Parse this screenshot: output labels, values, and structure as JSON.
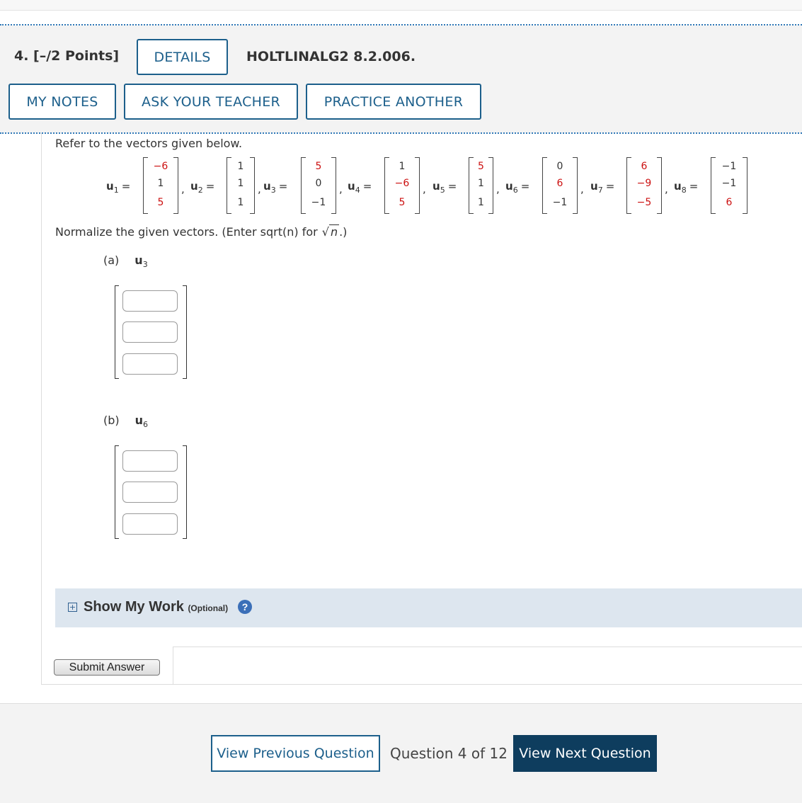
{
  "question": {
    "number_label": "4. [–/2 Points]",
    "details_label": "DETAILS",
    "code": "HOLTLINALG2 8.2.006.",
    "buttons": {
      "my_notes": "MY NOTES",
      "ask_teacher": "ASK YOUR TEACHER",
      "practice_another": "PRACTICE ANOTHER"
    }
  },
  "body": {
    "prompt": "Refer to the vectors given below.",
    "vectors": [
      {
        "name": "u",
        "sub": "1",
        "entries": [
          "−6",
          "1",
          "5"
        ],
        "red": [
          true,
          false,
          true
        ]
      },
      {
        "name": "u",
        "sub": "2",
        "entries": [
          "1",
          "1",
          "1"
        ],
        "red": [
          false,
          false,
          false
        ]
      },
      {
        "name": "u",
        "sub": "3",
        "entries": [
          "5",
          "0",
          "−1"
        ],
        "red": [
          true,
          false,
          false
        ]
      },
      {
        "name": "u",
        "sub": "4",
        "entries": [
          "1",
          "−6",
          "5"
        ],
        "red": [
          false,
          true,
          true
        ]
      },
      {
        "name": "u",
        "sub": "5",
        "entries": [
          "5",
          "1",
          "1"
        ],
        "red": [
          true,
          false,
          false
        ]
      },
      {
        "name": "u",
        "sub": "6",
        "entries": [
          "0",
          "6",
          "−1"
        ],
        "red": [
          false,
          true,
          false
        ]
      },
      {
        "name": "u",
        "sub": "7",
        "entries": [
          "6",
          "−9",
          "−5"
        ],
        "red": [
          true,
          true,
          true
        ]
      },
      {
        "name": "u",
        "sub": "8",
        "entries": [
          "−1",
          "−1",
          "6"
        ],
        "red": [
          false,
          false,
          true
        ]
      }
    ],
    "instruction": "Normalize the given vectors. (Enter sqrt(n) for",
    "instruction_radicand": "n",
    "instruction_end": ".)",
    "parts": [
      {
        "label": "(a)",
        "vector": "u",
        "sub": "3"
      },
      {
        "label": "(b)",
        "vector": "u",
        "sub": "6"
      }
    ]
  },
  "show_my_work": {
    "title": "Show My Work",
    "optional": "(Optional)",
    "help": "?"
  },
  "submit_label": "Submit Answer",
  "footer": {
    "prev_label": "View Previous Question",
    "counter": "Question 4 of 12",
    "next_label": "View Next Question"
  },
  "colors": {
    "accent": "#1c5f8b",
    "dotted_rule": "#2f78b7",
    "highlight_red": "#cc1111",
    "next_button_bg": "#0e3d5e",
    "work_band": "#dde6ef"
  },
  "icons": [
    "plus-box-icon",
    "help-circle-icon"
  ]
}
